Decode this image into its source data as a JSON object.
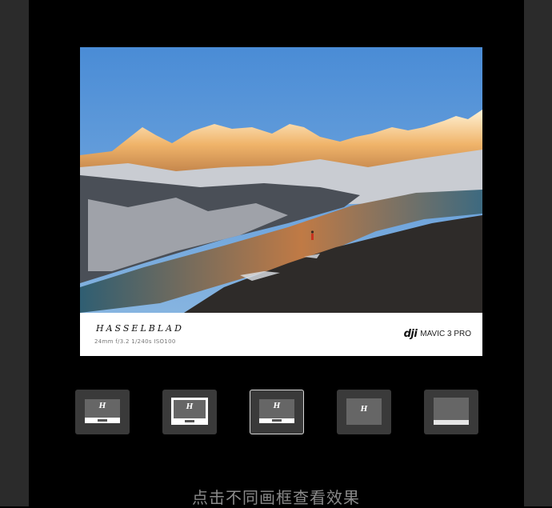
{
  "card": {
    "brand": "HASSELBLAD",
    "specs": "24mm  f/3.2  1/240s  ISO100",
    "camera_logo": "dji",
    "camera_model": "MAVIC 3 PRO"
  },
  "frames": [
    {
      "label": "frame-1",
      "glyph": "H"
    },
    {
      "label": "frame-2",
      "glyph": "H"
    },
    {
      "label": "frame-3",
      "glyph": "H"
    },
    {
      "label": "frame-4",
      "glyph": "H"
    },
    {
      "label": "frame-5",
      "glyph": ""
    }
  ],
  "selected_frame": 3,
  "hint": "点击不同画框查看效果"
}
